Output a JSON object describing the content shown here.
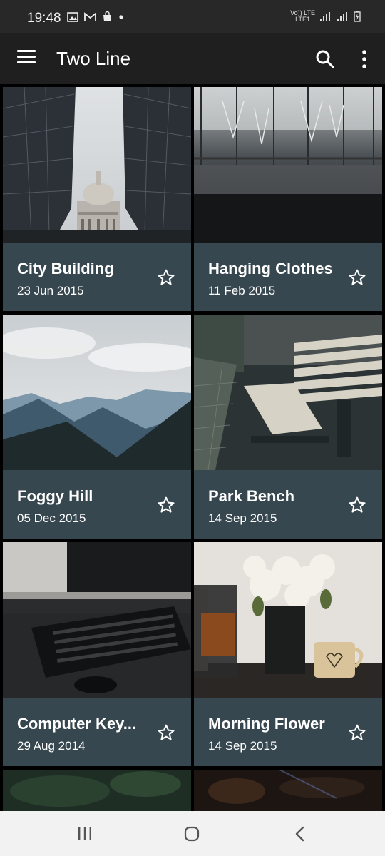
{
  "status": {
    "time": "19:48",
    "network_top": "Vo)) LTE",
    "network_bottom": "LTE1"
  },
  "app_bar": {
    "title": "Two Line",
    "icons": [
      "menu-icon",
      "search-icon",
      "more-vert-icon"
    ]
  },
  "cards": [
    {
      "title": "City Building",
      "date": "23 Jun 2015",
      "starred": false
    },
    {
      "title": "Hanging Clothes",
      "date": "11 Feb 2015",
      "starred": false
    },
    {
      "title": "Foggy Hill",
      "date": "05 Dec 2015",
      "starred": false
    },
    {
      "title": "Park Bench",
      "date": "14 Sep 2015",
      "starred": false
    },
    {
      "title": "Computer Key...",
      "date": "29 Aug 2014",
      "starred": false
    },
    {
      "title": "Morning Flower",
      "date": "14 Sep 2015",
      "starred": false
    }
  ],
  "colors": {
    "caption_bg": "#37474f",
    "app_bar_bg": "#1f1f1f",
    "status_bg": "#282828",
    "nav_bg": "#f2f2f2"
  }
}
